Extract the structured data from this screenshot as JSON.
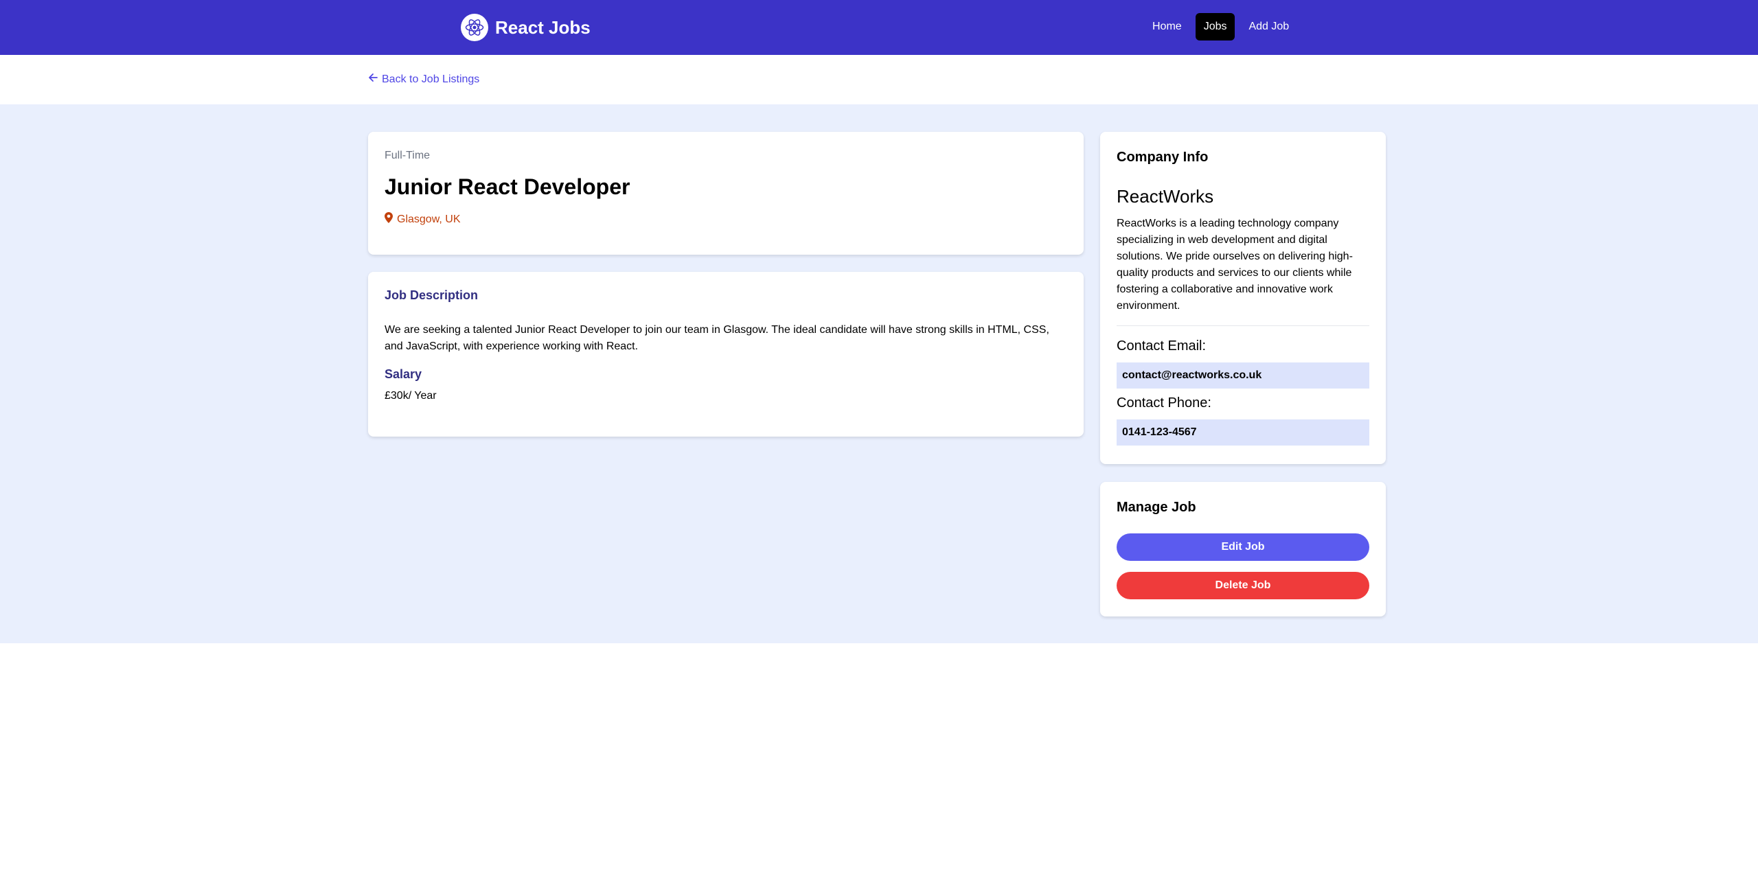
{
  "nav": {
    "brand": "React Jobs",
    "logo_icon": "react-atom-icon",
    "links": [
      {
        "label": "Home",
        "active": false
      },
      {
        "label": "Jobs",
        "active": true
      },
      {
        "label": "Add Job",
        "active": false
      }
    ]
  },
  "back_link": {
    "label": "Back to Job Listings",
    "icon": "arrow-left-icon"
  },
  "job": {
    "type": "Full-Time",
    "title": "Junior React Developer",
    "location": "Glasgow, UK",
    "location_icon": "map-marker-icon",
    "description_heading": "Job Description",
    "description": "We are seeking a talented Junior React Developer to join our team in Glasgow. The ideal candidate will have strong skills in HTML, CSS, and JavaScript, with experience working with React.",
    "salary_heading": "Salary",
    "salary": "£30k/ Year"
  },
  "company": {
    "heading": "Company Info",
    "name": "ReactWorks",
    "description": "ReactWorks is a leading technology company specializing in web development and digital solutions. We pride ourselves on delivering high-quality products and services to our clients while fostering a collaborative and innovative work environment.",
    "email_label": "Contact Email:",
    "email": "contact@reactworks.co.uk",
    "phone_label": "Contact Phone:",
    "phone": "0141-123-4567"
  },
  "manage": {
    "heading": "Manage Job",
    "edit_label": "Edit Job",
    "delete_label": "Delete Job"
  },
  "colors": {
    "nav_bg": "#3c33c7",
    "page_bg": "#e9effd",
    "accent": "#4f46e5",
    "location": "#c2410c",
    "edit": "#5b5bef",
    "delete": "#ef3b3b"
  }
}
